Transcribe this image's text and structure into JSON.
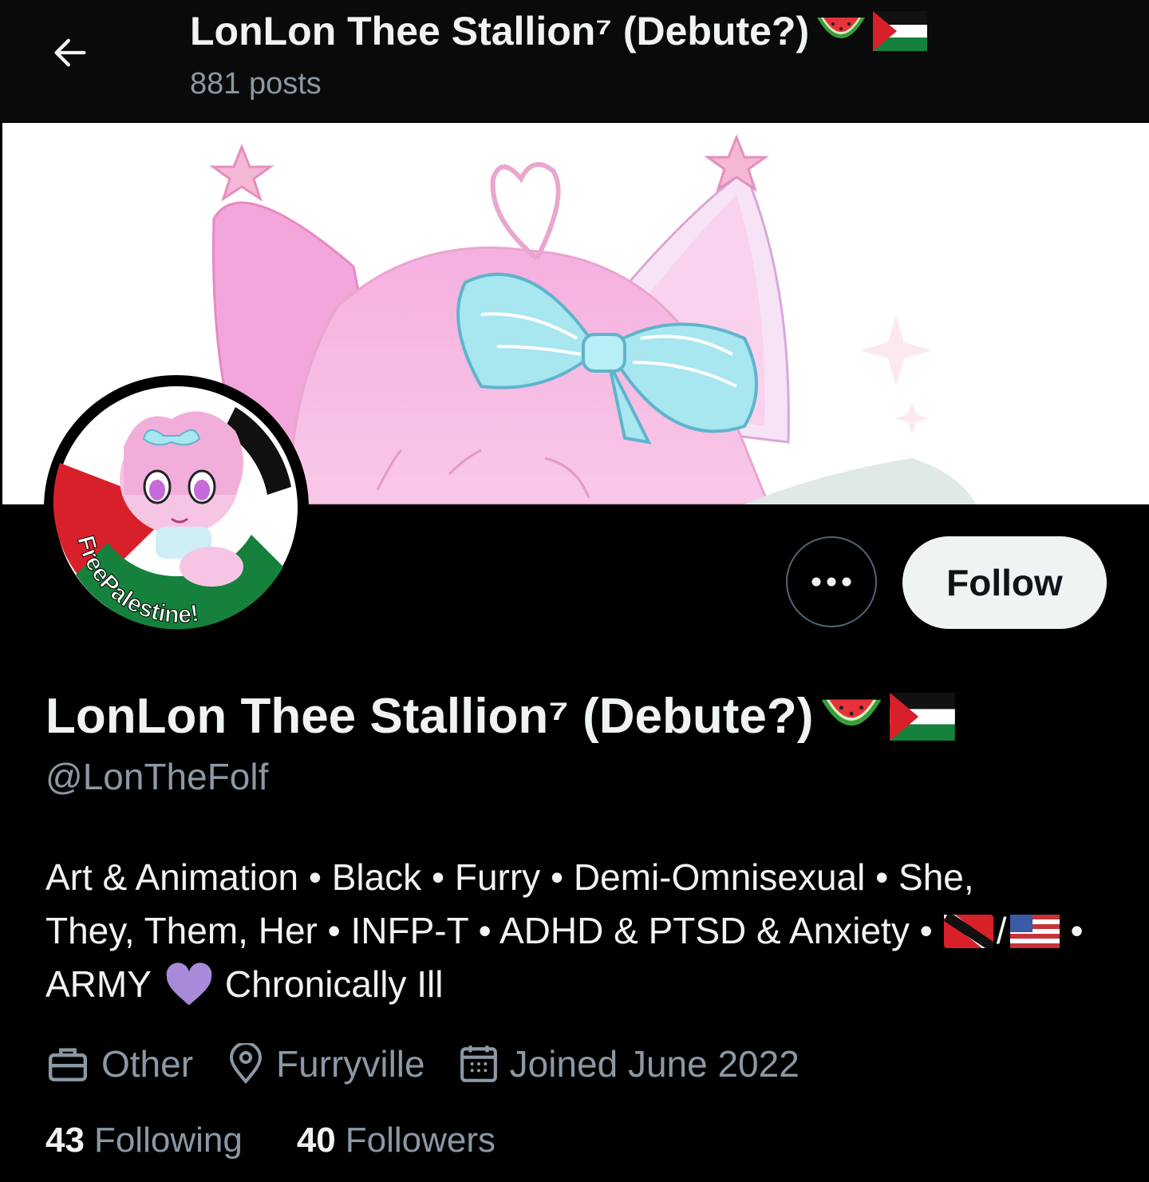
{
  "header": {
    "title": "LonLon Thee Stallion⁷ (Debute?)",
    "posts": "881 posts"
  },
  "profile": {
    "display_name": "LonLon Thee Stallion⁷ (Debute?)",
    "handle": "@LonTheFolf",
    "avatar_text": "FreePalestine!",
    "follow_label": "Follow",
    "more_icon": "more-icon",
    "bio": {
      "line1": "Art & Animation • Black • Furry • Demi-Omnisexual • She,",
      "line2_text": "They, Them, Her • INFP-T • ADHD & PTSD & Anxiety •",
      "line2_sep": "/",
      "line2_end": "•",
      "line3_a": "ARMY",
      "line3_b": "Chronically Ill"
    },
    "meta": {
      "category": "Other",
      "location": "Furryville",
      "joined": "Joined June 2022"
    },
    "stats": {
      "following_count": "43",
      "following_label": "Following",
      "followers_count": "40",
      "followers_label": "Followers"
    }
  },
  "colors": {
    "background": "#000000",
    "muted_text": "#8b98a5",
    "follow_bg": "#eff3f4",
    "heart_purple": "#a78bd8"
  }
}
